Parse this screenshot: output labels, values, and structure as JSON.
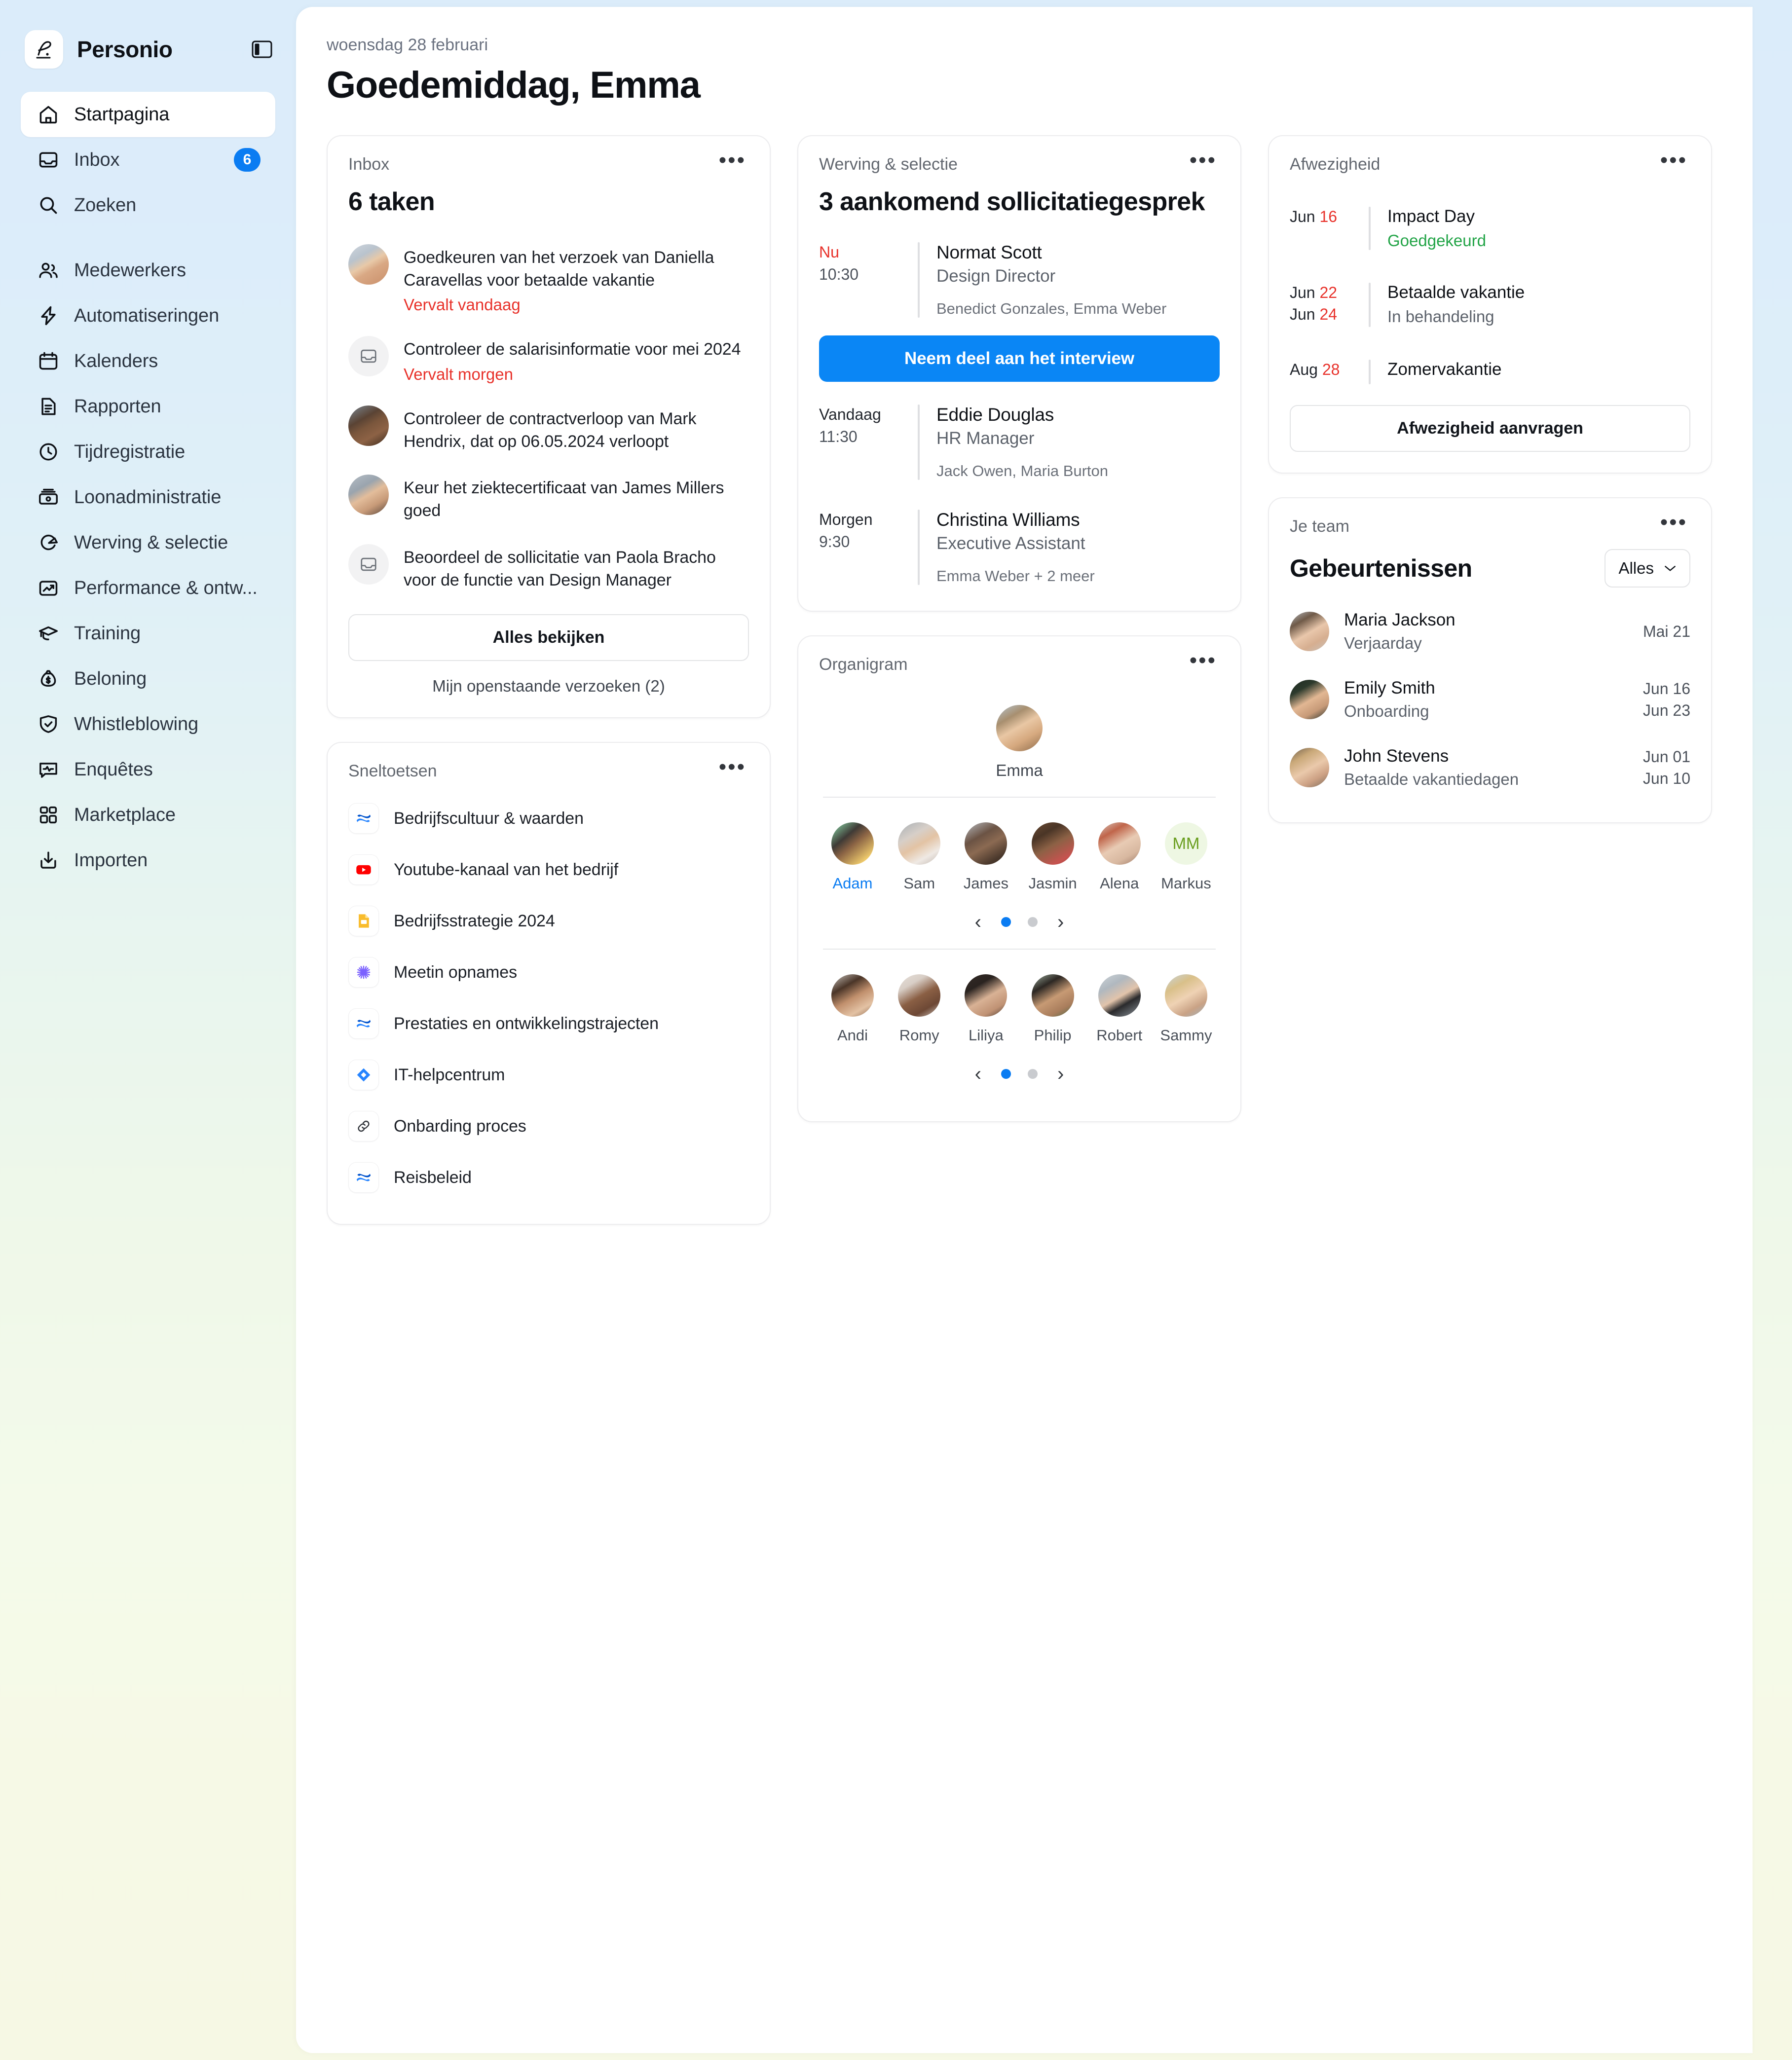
{
  "brand": {
    "name": "Personio",
    "logo_icon": "personio-logo",
    "toggle_icon": "sidebar-toggle-icon"
  },
  "sidebar": {
    "primary": [
      {
        "label": "Startpagina",
        "icon": "home-icon",
        "active": true
      },
      {
        "label": "Inbox",
        "icon": "inbox-icon",
        "badge": "6"
      },
      {
        "label": "Zoeken",
        "icon": "search-icon"
      }
    ],
    "secondary": [
      {
        "label": "Medewerkers",
        "icon": "users-icon"
      },
      {
        "label": "Automatiseringen",
        "icon": "bolt-icon"
      },
      {
        "label": "Kalenders",
        "icon": "calendar-icon"
      },
      {
        "label": "Rapporten",
        "icon": "document-icon"
      },
      {
        "label": "Tijdregistratie",
        "icon": "clock-icon"
      },
      {
        "label": "Loonadministratie",
        "icon": "payroll-icon"
      },
      {
        "label": "Werving & selectie",
        "icon": "recruiting-icon"
      },
      {
        "label": "Performance & ontw...",
        "icon": "chart-up-icon"
      },
      {
        "label": "Training",
        "icon": "graduation-cap-icon"
      },
      {
        "label": "Beloning",
        "icon": "money-bag-icon"
      },
      {
        "label": "Whistleblowing",
        "icon": "shield-check-icon"
      },
      {
        "label": "Enquêtes",
        "icon": "survey-icon"
      },
      {
        "label": "Marketplace",
        "icon": "grid-icon"
      },
      {
        "label": "Importen",
        "icon": "import-icon"
      }
    ]
  },
  "header": {
    "date": "woensdag 28 februari",
    "greeting": "Goedemiddag, Emma"
  },
  "inbox_card": {
    "eyebrow": "Inbox",
    "title": "6 taken",
    "tasks": [
      {
        "text": "Goedkeuren van het verzoek van Daniella Caravellas voor betaalde vakantie",
        "due": "Vervalt vandaag",
        "avatar": "woman-red-hair",
        "has_photo": true
      },
      {
        "text": "Controleer de salarisinformatie voor mei 2024",
        "due": "Vervalt morgen",
        "avatar": "inbox-icon",
        "has_photo": false
      },
      {
        "text": "Controleer de contractverloop van Mark Hendrix, dat op 06.05.2024 verloopt",
        "due": "",
        "avatar": "young-man-curly",
        "has_photo": true
      },
      {
        "text": "Keur het ziektecertificaat van James Millers goed",
        "due": "",
        "avatar": "man-glasses-beard",
        "has_photo": true
      },
      {
        "text": "Beoordeel de sollicitatie van Paola Bracho voor de functie van Design Manager",
        "due": "",
        "avatar": "inbox-icon",
        "has_photo": false
      }
    ],
    "view_all": "Alles bekijken",
    "open_requests": "Mijn openstaande verzoeken (2)"
  },
  "shortcuts_card": {
    "eyebrow": "Sneltoetsen",
    "items": [
      {
        "label": "Bedrijfscultuur & waarden",
        "icon": "confluence-icon"
      },
      {
        "label": "Youtube-kanaal van het bedrijf",
        "icon": "youtube-icon"
      },
      {
        "label": "Bedrijfsstrategie 2024",
        "icon": "google-slides-icon"
      },
      {
        "label": "Meetin opnames",
        "icon": "asterisk-icon"
      },
      {
        "label": "Prestaties en ontwikkelingstrajecten",
        "icon": "confluence-icon"
      },
      {
        "label": "IT-helpcentrum",
        "icon": "jira-icon"
      },
      {
        "label": "Onbarding proces",
        "icon": "link-icon"
      },
      {
        "label": "Reisbeleid",
        "icon": "confluence-icon"
      }
    ]
  },
  "recruiting_card": {
    "eyebrow": "Werving & selectie",
    "title": "3 aankomend sollicitatiegesprek",
    "join_button": "Neem deel aan het interview",
    "interviews": [
      {
        "relative": "Nu",
        "is_now": true,
        "time": "10:30",
        "name": "Normat Scott",
        "role": "Design Director",
        "people": "Benedict Gonzales, Emma Weber"
      },
      {
        "relative": "Vandaag",
        "is_now": false,
        "time": "11:30",
        "name": "Eddie Douglas",
        "role": "HR Manager",
        "people": "Jack Owen, Maria Burton"
      },
      {
        "relative": "Morgen",
        "is_now": false,
        "time": "9:30",
        "name": "Christina Williams",
        "role": "Executive Assistant",
        "people": "Emma Weber + 2 meer"
      }
    ]
  },
  "org_card": {
    "eyebrow": "Organigram",
    "root": {
      "name": "Emma",
      "avatar": "woman-curly-blonde"
    },
    "row_one": [
      {
        "name": "Adam",
        "avatar": "man-beard-glasses-colorful",
        "highlight": true
      },
      {
        "name": "Sam",
        "avatar": "older-man-white-beard"
      },
      {
        "name": "James",
        "avatar": "man-glasses-dark"
      },
      {
        "name": "Jasmin",
        "avatar": "woman-curly-dark"
      },
      {
        "name": "Alena",
        "avatar": "older-woman-red-hair"
      },
      {
        "name": "Markus",
        "initials": "MM",
        "initials_bg": "#eef7e3",
        "initials_color": "#6a9e1f"
      }
    ],
    "row_one_page": 1,
    "row_one_pages": 2,
    "row_two": [
      {
        "name": "Andi",
        "avatar": "man-smiling-beard"
      },
      {
        "name": "Romy",
        "avatar": "woman-headscarf"
      },
      {
        "name": "Liliya",
        "avatar": "woman-dark-hair-asian"
      },
      {
        "name": "Philip",
        "avatar": "young-man-asian"
      },
      {
        "name": "Robert",
        "avatar": "man-black-glasses"
      },
      {
        "name": "Sammy",
        "avatar": "blonde-man-glasses"
      }
    ],
    "row_two_page": 1,
    "row_two_pages": 2,
    "prev_icon": "chevron-left-icon",
    "next_icon": "chevron-right-icon"
  },
  "absence_card": {
    "eyebrow": "Afwezigheid",
    "request_button": "Afwezigheid aanvragen",
    "rows": [
      {
        "month_1": "Jun",
        "day_1": "16",
        "month_2": "",
        "day_2": "",
        "title": "Impact Day",
        "status": "Goedgekeurd",
        "status_ok": true
      },
      {
        "month_1": "Jun",
        "day_1": "22",
        "month_2": "Jun",
        "day_2": "24",
        "title": "Betaalde vakantie",
        "status": "In behandeling",
        "status_ok": false
      },
      {
        "month_1": "Aug",
        "day_1": "28",
        "month_2": "",
        "day_2": "",
        "title": "Zomervakantie",
        "status": "",
        "status_ok": false
      }
    ]
  },
  "team_card": {
    "eyebrow": "Je team",
    "heading": "Gebeurtenissen",
    "filter": {
      "label": "Alles",
      "icon": "chevron-down-icon"
    },
    "events": [
      {
        "name": "Maria Jackson",
        "kind": "Verjaarday",
        "date_1": "Mai 21",
        "date_2": "",
        "avatar": "woman-short-hair"
      },
      {
        "name": "Emily Smith",
        "kind": "Onboarding",
        "date_1": "Jun 16",
        "date_2": "Jun 23",
        "avatar": "woman-smiling-asian"
      },
      {
        "name": "John Stevens",
        "kind": "Betaalde vakantiedagen",
        "date_1": "Jun 01",
        "date_2": "Jun 10",
        "avatar": "man-blonde-smiling"
      }
    ]
  },
  "colors": {
    "accent_blue": "#0a86f5",
    "badge_blue": "#0a7cf2",
    "danger_red": "#e8322b",
    "success_green": "#22a447",
    "sidebar_top": "#dbecfa",
    "sidebar_bottom": "#f6f8e4"
  }
}
